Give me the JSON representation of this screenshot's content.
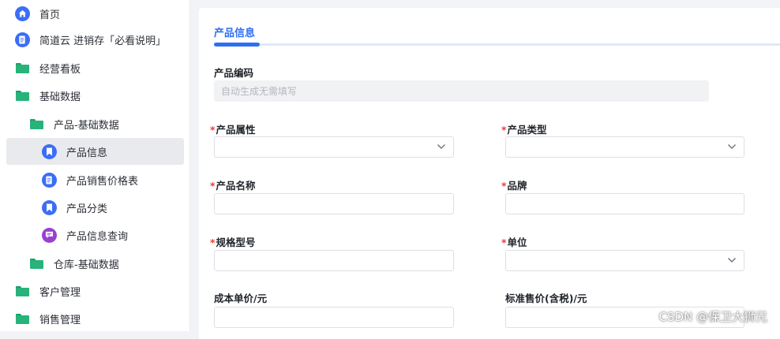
{
  "sidebar": {
    "items": [
      {
        "label": "首页",
        "icon": "home-icon"
      },
      {
        "label": "简道云 进销存「必看说明」",
        "icon": "document-icon"
      },
      {
        "label": "经营看板",
        "icon": "folder-icon"
      },
      {
        "label": "基础数据",
        "icon": "folder-icon"
      },
      {
        "label": "产品-基础数据",
        "icon": "folder-icon"
      },
      {
        "label": "产品信息",
        "icon": "bookmark-icon",
        "active": true
      },
      {
        "label": "产品销售价格表",
        "icon": "document-icon"
      },
      {
        "label": "产品分类",
        "icon": "bookmark-icon"
      },
      {
        "label": "产品信息查询",
        "icon": "chat-icon"
      },
      {
        "label": "仓库-基础数据",
        "icon": "folder-icon"
      },
      {
        "label": "客户管理",
        "icon": "folder-icon"
      },
      {
        "label": "销售管理",
        "icon": "folder-icon"
      }
    ]
  },
  "form": {
    "tab": "产品信息",
    "required_mark": "*",
    "code": {
      "label": "产品编码",
      "placeholder": "自动生成无需填写"
    },
    "attribute": {
      "label": "产品属性",
      "value": ""
    },
    "type": {
      "label": "产品类型",
      "value": ""
    },
    "name": {
      "label": "产品名称",
      "value": ""
    },
    "brand": {
      "label": "品牌",
      "value": ""
    },
    "spec": {
      "label": "规格型号",
      "value": ""
    },
    "unit": {
      "label": "单位",
      "value": ""
    },
    "cost": {
      "label": "成本单价/元",
      "value": ""
    },
    "price": {
      "label": "标准售价(含税)/元",
      "value": ""
    }
  },
  "watermark": "CSDN @保卫大狮兄",
  "colors": {
    "accent": "#2e6ef5",
    "folder": "#27b37a",
    "required": "#ee3b3b",
    "chat": "#9b3fd1"
  }
}
